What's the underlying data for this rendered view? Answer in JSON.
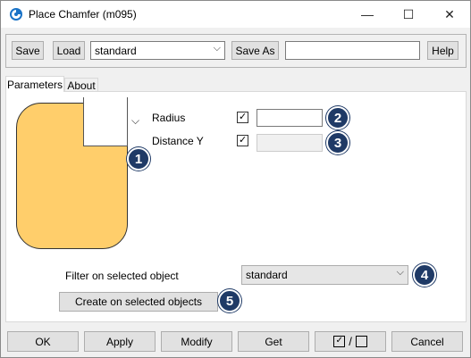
{
  "window": {
    "title": "Place Chamfer (m095)",
    "minimize": "—",
    "maximize": "☐",
    "close": "✕",
    "accent": "#1f3a66"
  },
  "toolbar": {
    "save_label": "Save",
    "load_label": "Load",
    "preset_value": "standard",
    "save_as_label": "Save As",
    "save_as_name": "",
    "help_label": "Help"
  },
  "tabs": [
    {
      "label": "Parameters",
      "active": true
    },
    {
      "label": "About",
      "active": false
    }
  ],
  "params": {
    "radius_label": "Radius",
    "radius_checked": true,
    "radius_value": "",
    "distance_label": "Distance Y",
    "distance_checked": true,
    "distance_value": "",
    "preview_color": "#ffce6b"
  },
  "filter": {
    "label": "Filter on selected object",
    "value": "standard"
  },
  "create_label": "Create on selected objects",
  "badges": [
    "1",
    "2",
    "3",
    "4",
    "5"
  ],
  "bottom": {
    "ok": "OK",
    "apply": "Apply",
    "modify": "Modify",
    "get": "Get",
    "toggle_slash": "/",
    "cancel": "Cancel"
  }
}
